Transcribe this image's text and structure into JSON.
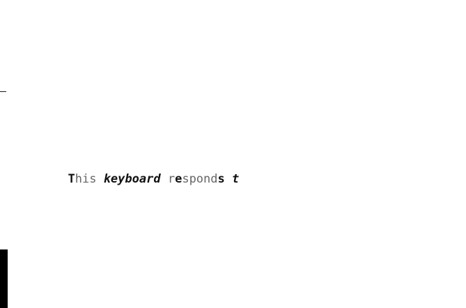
{
  "typing_test": {
    "segments": [
      {
        "text": "T",
        "style": "k"
      },
      {
        "text": "his ",
        "style": "n"
      },
      {
        "text": "keyboard",
        "style": "ki"
      },
      {
        "text": " ",
        "style": "n"
      },
      {
        "text": "r",
        "style": "n"
      },
      {
        "text": "e",
        "style": "k"
      },
      {
        "text": "spond",
        "style": "n"
      },
      {
        "text": "s",
        "style": "k"
      },
      {
        "text": " ",
        "style": "n"
      },
      {
        "text": "t",
        "style": "ki"
      }
    ]
  }
}
